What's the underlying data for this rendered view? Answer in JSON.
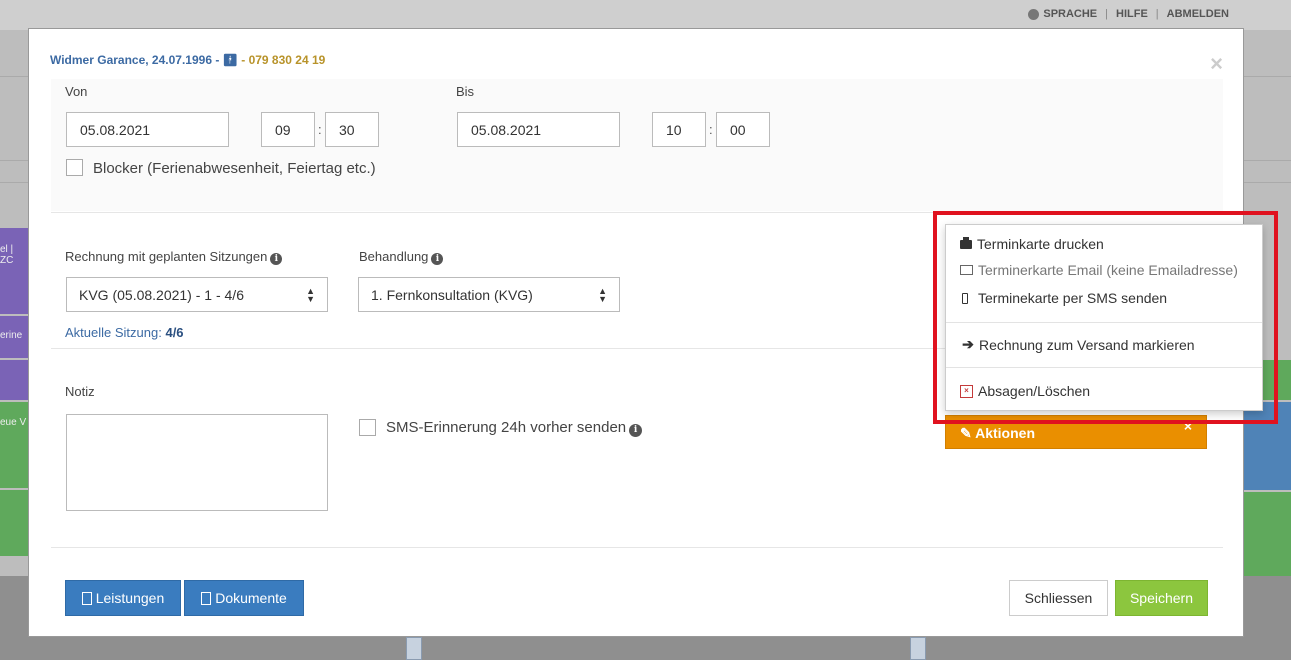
{
  "topnav": {
    "language": "SPRACHE",
    "help": "HILFE",
    "logout": "ABMELDEN"
  },
  "background": {
    "left_text_1": "el | ZC",
    "left_text_2": "erine",
    "left_text_3": "eue V"
  },
  "patient": {
    "name": "Widmer Garance, 24.07.1996",
    "sep1": " - ",
    "sep2": " - ",
    "phone": "079 830 24 19"
  },
  "time": {
    "from_label": "Von",
    "to_label": "Bis",
    "from_date": "05.08.2021",
    "from_hour": "09",
    "from_min": "30",
    "to_date": "05.08.2021",
    "to_hour": "10",
    "to_min": "00",
    "colon": ":",
    "blocker_label": "Blocker (Ferienabwesenheit, Feiertag etc.)"
  },
  "billing": {
    "invoice_label": "Rechnung mit geplanten Sitzungen",
    "invoice_value": "KVG (05.08.2021) - 1 - 4/6",
    "treatment_label": "Behandlung",
    "treatment_value": "1. Fernkonsultation (KVG)",
    "session_label": "Aktuelle Sitzung:",
    "session_value": "4/6"
  },
  "note": {
    "label": "Notiz",
    "sms_label": "SMS-Erinnerung 24h vorher senden"
  },
  "actions": {
    "button_label": "Aktionen",
    "menu": [
      {
        "label": "Terminkarte drucken"
      },
      {
        "label": "Terminerkarte Email (keine Emailadresse)"
      },
      {
        "label": "Terminekarte per SMS senden"
      },
      {
        "label": "Rechnung zum Versand markieren"
      },
      {
        "label": "Absagen/Löschen"
      }
    ]
  },
  "footer": {
    "services": "Leistungen",
    "documents": "Dokumente",
    "close": "Schliessen",
    "save": "Speichern"
  }
}
